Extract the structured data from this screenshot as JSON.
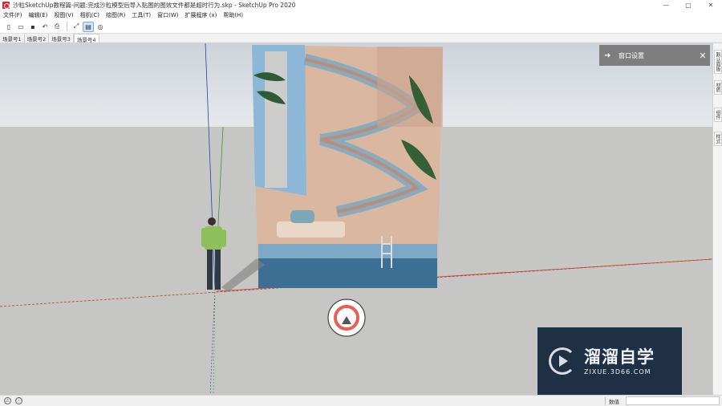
{
  "app": {
    "title": "沙粒SketchUp教程篇-问题:完成沙粒模型后导入贴图的图效文件都是超时行为.skp - SketchUp Pro 2020",
    "window_controls": {
      "minimize": "—",
      "maximize": "▢",
      "close": "✕"
    }
  },
  "menu": {
    "items": [
      "文件(F)",
      "编辑(E)",
      "视图(V)",
      "相机(C)",
      "绘图(R)",
      "工具(T)",
      "窗口(W)",
      "扩展程序 (x)",
      "帮助(H)"
    ]
  },
  "toolbar": {
    "buttons": [
      {
        "name": "new-icon",
        "glyph": "▯"
      },
      {
        "name": "open-icon",
        "glyph": "▭"
      },
      {
        "name": "save-icon",
        "glyph": "▪"
      },
      {
        "name": "undo-icon",
        "glyph": "↶"
      },
      {
        "name": "print-icon",
        "glyph": "⎙"
      },
      {
        "name": "section-icon",
        "glyph": "⤢"
      },
      {
        "name": "scene-icon",
        "glyph": "▤"
      },
      {
        "name": "style-icon",
        "glyph": "◎"
      }
    ]
  },
  "scenes": {
    "tabs": [
      "场景号1",
      "场景号2",
      "场景号3",
      "场景号4"
    ],
    "active_index": 3
  },
  "dock": {
    "tabs": [
      "默认面板",
      "材质",
      "组件",
      "样式"
    ]
  },
  "panel": {
    "title": "窗口设置",
    "arrow": "➜",
    "close": "✕"
  },
  "status": {
    "left_icons": [
      "⚠",
      "ⓘ"
    ],
    "measure_label": "数值"
  },
  "watermark": {
    "brand": "溜溜自学",
    "url": "ZIXUE.3D66.COM"
  },
  "colors": {
    "accent_blue": "#7aaee0",
    "axis_red": "#c0392b",
    "axis_green": "#2e9a3c",
    "axis_blue": "#2b3fa0",
    "panel_bg": "#7e7e7e",
    "watermark_bg": "#1f2f44"
  }
}
